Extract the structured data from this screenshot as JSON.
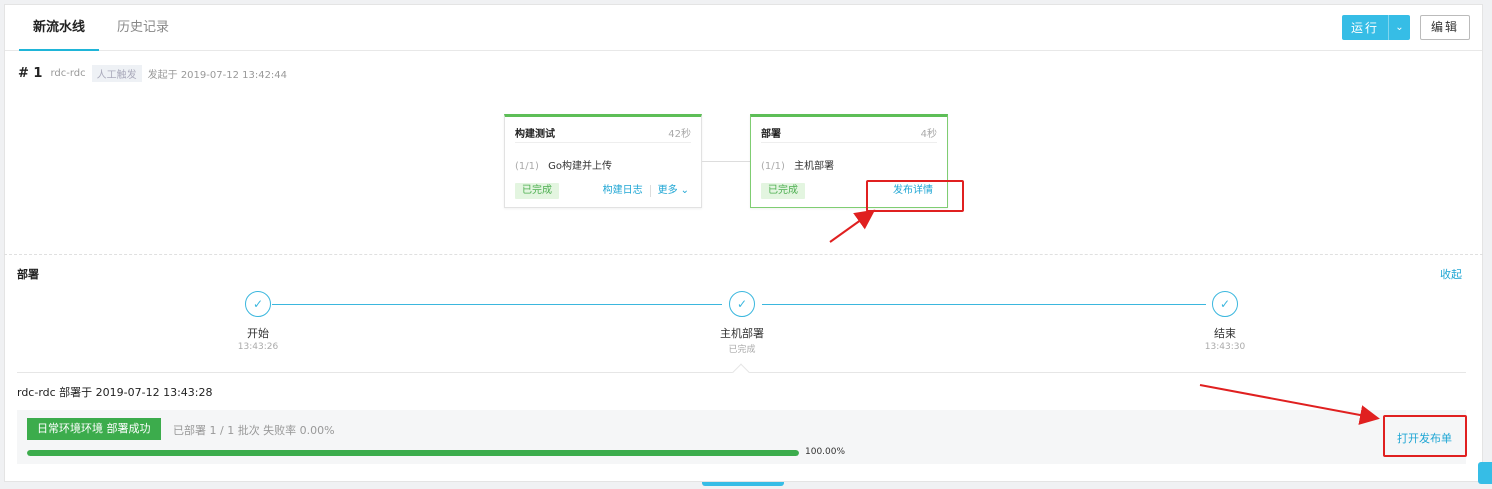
{
  "tabs": [
    {
      "label": "新流水线",
      "active": true
    },
    {
      "label": "历史记录",
      "active": false
    }
  ],
  "header": {
    "run_label": "运行",
    "edit_label": "编辑"
  },
  "run_info": {
    "number": "# 1",
    "repo": "rdc-rdc",
    "trigger_badge": "人工触发",
    "started": "发起于 2019-07-12 13:42:44"
  },
  "stages": [
    {
      "title": "构建测试",
      "duration": "42秒",
      "job_count": "(1/1)",
      "job_name": "Go构建并上传",
      "status": "已完成",
      "links": [
        "构建日志",
        "更多"
      ]
    },
    {
      "title": "部署",
      "duration": "4秒",
      "job_count": "(1/1)",
      "job_name": "主机部署",
      "status": "已完成",
      "links": [
        "发布详情"
      ]
    }
  ],
  "deploy": {
    "section_title": "部署",
    "collapse_label": "收起",
    "steps": [
      {
        "label": "开始",
        "sub": "13:43:26"
      },
      {
        "label": "主机部署",
        "sub": "已完成"
      },
      {
        "label": "结束",
        "sub": "13:43:30"
      }
    ],
    "info": "rdc-rdc 部署于 2019-07-12 13:43:28",
    "env_label": "日常环境环境 部署成功",
    "env_meta": "已部署 1 / 1 批次  失败率 0.00%",
    "progress_pct": 100,
    "progress_text": "100.00%",
    "open_link": "打开发布单"
  },
  "colors": {
    "accent": "#36bde6",
    "success": "#3cac4c",
    "link": "#1fa6d4",
    "annotation": "#e02020"
  },
  "icons": {
    "run_dropdown": "chevron-down-icon",
    "more_dropdown": "chevron-down-icon",
    "step_done": "check-icon"
  }
}
